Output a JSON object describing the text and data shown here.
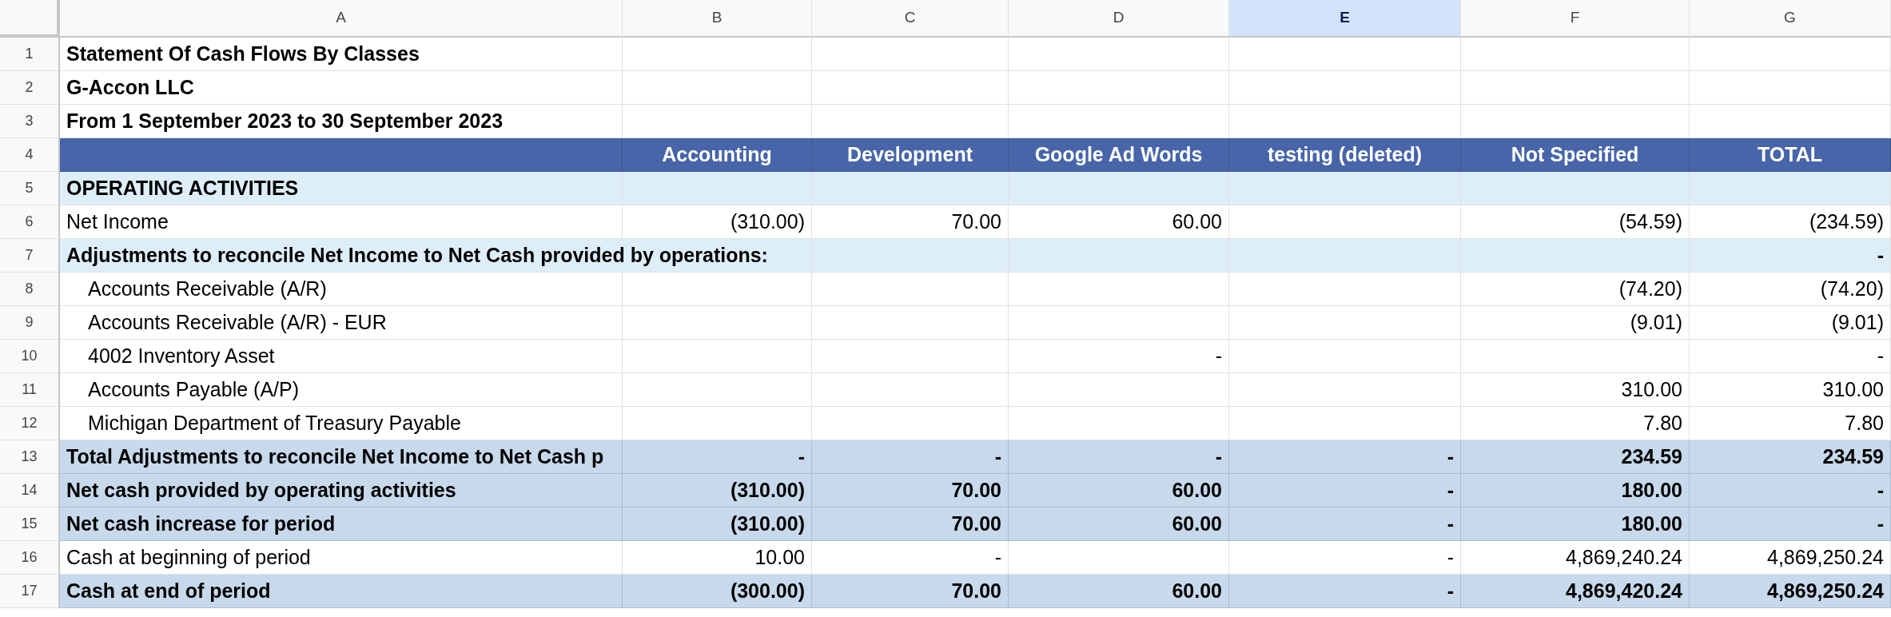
{
  "columns": [
    {
      "letter": "A",
      "selected": false
    },
    {
      "letter": "B",
      "selected": false
    },
    {
      "letter": "C",
      "selected": false
    },
    {
      "letter": "D",
      "selected": false
    },
    {
      "letter": "E",
      "selected": true
    },
    {
      "letter": "F",
      "selected": false
    },
    {
      "letter": "G",
      "selected": false
    }
  ],
  "rows": [
    {
      "number": "1",
      "kind": "title",
      "cells": {
        "A": "Statement Of Cash Flows By Classes"
      }
    },
    {
      "number": "2",
      "kind": "title",
      "cells": {
        "A": "G-Accon LLC"
      }
    },
    {
      "number": "3",
      "kind": "title",
      "cells": {
        "A": "From 1 September 2023 to 30 September 2023"
      }
    },
    {
      "number": "4",
      "kind": "header",
      "cells": {
        "B": "Accounting",
        "C": "Development",
        "D": "Google Ad Words",
        "E": "testing (deleted)",
        "F": "Not Specified",
        "G": "TOTAL"
      }
    },
    {
      "number": "5",
      "kind": "section",
      "cells": {
        "A": "OPERATING ACTIVITIES"
      }
    },
    {
      "number": "6",
      "kind": "plain",
      "cells": {
        "A": "Net Income",
        "B": "(310.00)",
        "C": "70.00",
        "D": "60.00",
        "F": "(54.59)",
        "G": "(234.59)"
      }
    },
    {
      "number": "7",
      "kind": "section",
      "cells": {
        "A": "Adjustments to reconcile Net Income to Net Cash provided by operations:",
        "G": "-"
      }
    },
    {
      "number": "8",
      "kind": "indent",
      "cells": {
        "A": "Accounts Receivable (A/R)",
        "F": "(74.20)",
        "G": "(74.20)"
      }
    },
    {
      "number": "9",
      "kind": "indent",
      "cells": {
        "A": "Accounts Receivable (A/R) - EUR",
        "F": "(9.01)",
        "G": "(9.01)"
      }
    },
    {
      "number": "10",
      "kind": "indent",
      "cells": {
        "A": "4002 Inventory Asset",
        "D": "-",
        "G": "-"
      }
    },
    {
      "number": "11",
      "kind": "indent",
      "cells": {
        "A": "Accounts Payable (A/P)",
        "F": "310.00",
        "G": "310.00"
      }
    },
    {
      "number": "12",
      "kind": "indent",
      "cells": {
        "A": "Michigan Department of Treasury Payable",
        "F": "7.80",
        "G": "7.80"
      }
    },
    {
      "number": "13",
      "kind": "total",
      "cells": {
        "A": "Total Adjustments to reconcile Net Income to Net Cash p",
        "B": "-",
        "C": "-",
        "D": "-",
        "E": "-",
        "F": "234.59",
        "G": "234.59"
      }
    },
    {
      "number": "14",
      "kind": "total",
      "cells": {
        "A": "Net cash provided by operating activities",
        "B": "(310.00)",
        "C": "70.00",
        "D": "60.00",
        "E": "-",
        "F": "180.00",
        "G": "-"
      }
    },
    {
      "number": "15",
      "kind": "total",
      "cells": {
        "A": "Net cash increase for period",
        "B": "(310.00)",
        "C": "70.00",
        "D": "60.00",
        "E": "-",
        "F": "180.00",
        "G": "-"
      }
    },
    {
      "number": "16",
      "kind": "plain",
      "cells": {
        "A": "Cash at beginning of period",
        "B": "10.00",
        "C": "-",
        "E": "-",
        "F": "4,869,240.24",
        "G": "4,869,250.24"
      }
    },
    {
      "number": "17",
      "kind": "total",
      "cells": {
        "A": "Cash at end of period",
        "B": "(300.00)",
        "C": "70.00",
        "D": "60.00",
        "E": "-",
        "F": "4,869,420.24",
        "G": "4,869,250.24"
      }
    }
  ]
}
